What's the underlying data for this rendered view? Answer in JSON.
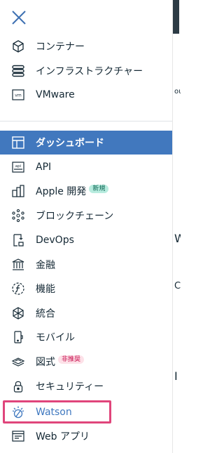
{
  "menu": {
    "top_items": [
      {
        "label": "コンテナー",
        "icon": "cube-icon"
      },
      {
        "label": "インフラストラクチャー",
        "icon": "server-stack-icon"
      },
      {
        "label": "VMware",
        "icon": "vm-icon"
      }
    ],
    "items": [
      {
        "label": "ダッシュボード",
        "icon": "dashboard-icon",
        "active": true
      },
      {
        "label": "API",
        "icon": "api-icon"
      },
      {
        "label": "Apple 開発",
        "icon": "apple-dev-icon",
        "badge": "新規"
      },
      {
        "label": "ブロックチェーン",
        "icon": "blockchain-icon"
      },
      {
        "label": "DevOps",
        "icon": "devops-icon"
      },
      {
        "label": "金融",
        "icon": "bank-icon"
      },
      {
        "label": "機能",
        "icon": "functions-icon"
      },
      {
        "label": "統合",
        "icon": "integration-icon"
      },
      {
        "label": "モバイル",
        "icon": "mobile-icon"
      },
      {
        "label": "図式",
        "icon": "schematics-icon",
        "badge": "非推奨"
      },
      {
        "label": "セキュリティー",
        "icon": "lock-icon"
      },
      {
        "label": "Watson",
        "icon": "watson-icon",
        "highlighted": true
      },
      {
        "label": "Web アプリ",
        "icon": "web-app-icon"
      }
    ]
  },
  "colors": {
    "accent": "#4178be",
    "watson": "#3f78bf",
    "highlight_border": "#e0457b",
    "badge_new_bg": "#b8ecdf",
    "badge_deprecated_bg": "#fde1e8"
  },
  "right_fragments": [
    "ou",
    "W",
    "C",
    "I"
  ]
}
